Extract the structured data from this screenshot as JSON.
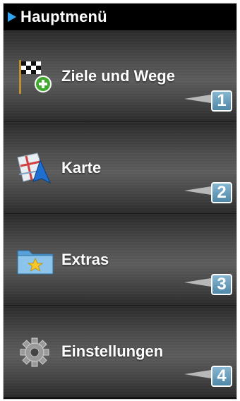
{
  "header": {
    "title": "Hauptmenü",
    "marker_color": "#2fa6f2"
  },
  "menu": {
    "items": [
      {
        "label": "Ziele und Wege",
        "number": "1",
        "icon": "checkered-flag-add-icon"
      },
      {
        "label": "Karte",
        "number": "2",
        "icon": "map-navigation-icon"
      },
      {
        "label": "Extras",
        "number": "3",
        "icon": "star-folder-icon"
      },
      {
        "label": "Einstellungen",
        "number": "4",
        "icon": "gear-icon"
      }
    ]
  },
  "colors": {
    "badge_top": "#87b7d1",
    "badge_bottom": "#4f87a8"
  }
}
